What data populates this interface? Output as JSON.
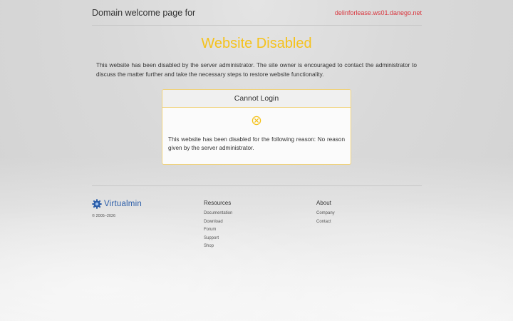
{
  "header": {
    "title": "Domain welcome page for",
    "domain": "delinforlease.ws01.danego.net"
  },
  "main": {
    "title": "Website Disabled",
    "description": "This website has been disabled by the server administrator. The site owner is encouraged to contact the administrator to discuss the matter further and take the necessary steps to restore website functionality."
  },
  "card": {
    "title": "Cannot Login",
    "icon": "circle-x-icon",
    "message": "This website has been disabled for the following reason: No reason given by the server administrator."
  },
  "footer": {
    "brand": {
      "name": "Virtualmin",
      "copyright": "© 2005–2026"
    },
    "resources": {
      "heading": "Resources",
      "links": [
        "Documentation",
        "Download",
        "Forum",
        "Support",
        "Shop"
      ]
    },
    "about": {
      "heading": "About",
      "links": [
        "Company",
        "Contact"
      ]
    }
  },
  "colors": {
    "accent": "#f5c21b",
    "domain_link": "#d9363e",
    "brand": "#2b5da8"
  }
}
